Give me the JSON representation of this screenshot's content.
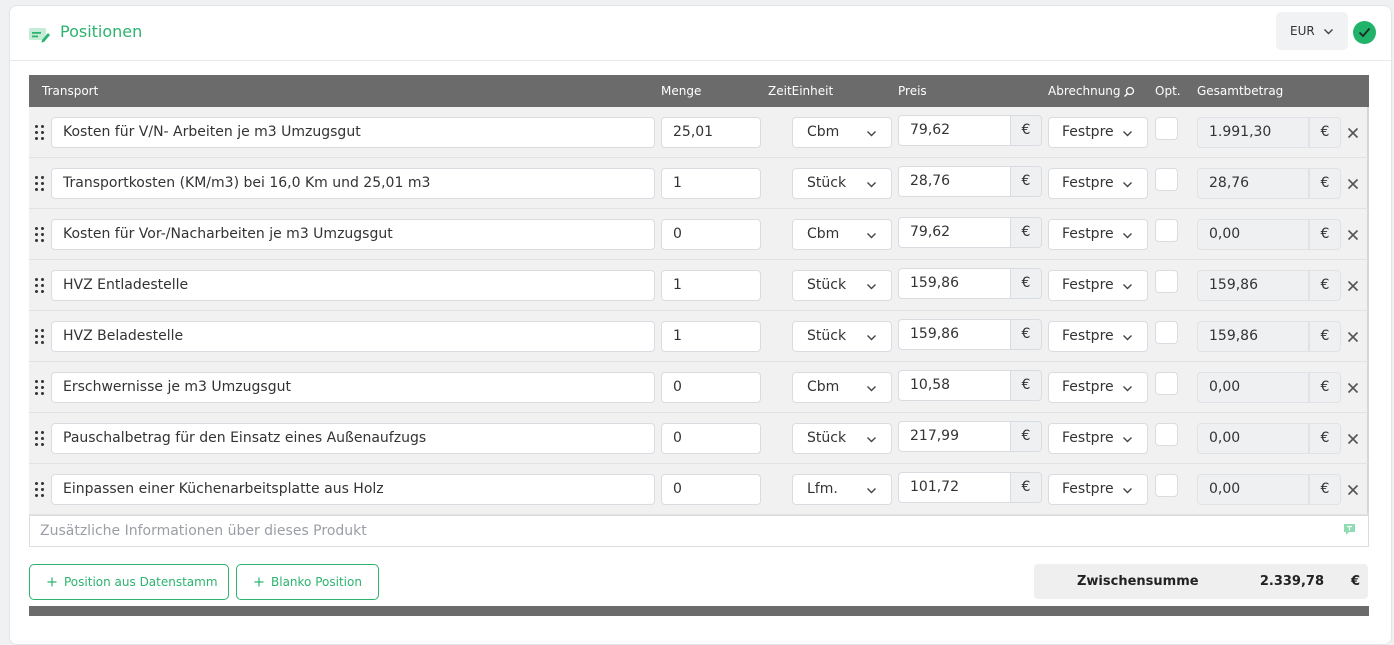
{
  "header": {
    "title": "Positionen",
    "currency": "EUR"
  },
  "columns": {
    "transport": "Transport",
    "menge": "Menge",
    "zeiteinheit": "ZeitEinheit",
    "preis": "Preis",
    "abrechnung": "Abrechnung",
    "opt": "Opt.",
    "gesamtbetrag": "Gesamtbetrag"
  },
  "rows": [
    {
      "name": "Kosten für V/N- Arbeiten je m3 Umzugsgut",
      "qty": "25,01",
      "unit": "Cbm",
      "price": "79,62",
      "price_currency": "€",
      "billing": "Festpre",
      "total": "1.991,30",
      "total_currency": "€"
    },
    {
      "name": "Transportkosten (KM/m3) bei 16,0 Km und 25,01 m3",
      "qty": "1",
      "unit": "Stück",
      "price": "28,76",
      "price_currency": "€",
      "billing": "Festpre",
      "total": "28,76",
      "total_currency": "€"
    },
    {
      "name": "Kosten für Vor-/Nacharbeiten je m3 Umzugsgut",
      "qty": "0",
      "unit": "Cbm",
      "price": "79,62",
      "price_currency": "€",
      "billing": "Festpre",
      "total": "0,00",
      "total_currency": "€"
    },
    {
      "name": "HVZ Entladestelle",
      "qty": "1",
      "unit": "Stück",
      "price": "159,86",
      "price_currency": "€",
      "billing": "Festpre",
      "total": "159,86",
      "total_currency": "€"
    },
    {
      "name": "HVZ Beladestelle",
      "qty": "1",
      "unit": "Stück",
      "price": "159,86",
      "price_currency": "€",
      "billing": "Festpre",
      "total": "159,86",
      "total_currency": "€"
    },
    {
      "name": "Erschwernisse je m3 Umzugsgut",
      "qty": "0",
      "unit": "Cbm",
      "price": "10,58",
      "price_currency": "€",
      "billing": "Festpre",
      "total": "0,00",
      "total_currency": "€"
    },
    {
      "name": "Pauschalbetrag für den Einsatz eines Außenaufzugs",
      "qty": "0",
      "unit": "Stück",
      "price": "217,99",
      "price_currency": "€",
      "billing": "Festpre",
      "total": "0,00",
      "total_currency": "€"
    },
    {
      "name": "Einpassen einer Küchenarbeitsplatte aus Holz",
      "qty": "0",
      "unit": "Lfm.",
      "price": "101,72",
      "price_currency": "€",
      "billing": "Festpre",
      "total": "0,00",
      "total_currency": "€"
    }
  ],
  "info": {
    "placeholder": "Zusätzliche Informationen über dieses Produkt"
  },
  "actions": {
    "from_database": "Position aus Datenstamm",
    "blank": "Blanko Position"
  },
  "subtotal": {
    "label": "Zwischensumme",
    "value": "2.339,78",
    "currency": "€"
  },
  "colors": {
    "accent": "#2db36f",
    "header_bg": "#6b6b6b",
    "row_bg": "#f1f1f1",
    "check": "#22b36a"
  },
  "icons": {
    "title": "edit-list-icon",
    "currency": "chevron-down-icon",
    "status": "check-icon",
    "drag": "drag-handle-icon",
    "remove": "close-icon",
    "add": "plus-icon",
    "info": "text-format-icon",
    "column_info": "magnifier-icon"
  }
}
